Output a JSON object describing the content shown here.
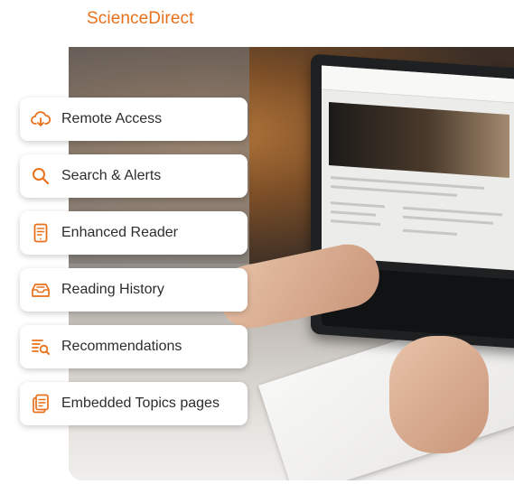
{
  "brand": {
    "name": "ScienceDirect",
    "color": "#e9711c"
  },
  "features": [
    {
      "label": "Remote Access",
      "icon": "cloud-download-icon"
    },
    {
      "label": "Search & Alerts",
      "icon": "search-icon"
    },
    {
      "label": "Enhanced Reader",
      "icon": "document-reader-icon"
    },
    {
      "label": "Reading History",
      "icon": "inbox-history-icon"
    },
    {
      "label": "Recommendations",
      "icon": "list-search-icon"
    },
    {
      "label": "Embedded Topics pages",
      "icon": "copy-pages-icon"
    }
  ],
  "colors": {
    "accent": "#e9711c",
    "text": "#2d2d2d",
    "pill_bg": "#ffffff"
  }
}
